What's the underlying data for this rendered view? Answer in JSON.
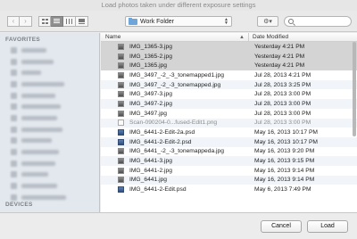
{
  "window": {
    "title": "Load photos taken under different exposure settings"
  },
  "toolbar": {
    "back_glyph": "‹",
    "forward_glyph": "›",
    "view_modes": [
      "icon-view",
      "list-view",
      "column-view",
      "cover-flow-view"
    ],
    "active_view": "list-view",
    "folder": "Work Folder",
    "action_glyph": "⚙▾",
    "search": {
      "value": "",
      "placeholder": ""
    }
  },
  "sidebar": {
    "favorites_heading": "FAVORITES",
    "devices_heading": "DEVICES",
    "items_count_note": ""
  },
  "filelist": {
    "columns": {
      "name": "Name",
      "date": "Date Modified"
    },
    "sort_glyph": "▲",
    "rows": [
      {
        "name": "IMG_1365-3.jpg",
        "date": "Yesterday 4:21 PM",
        "kind": "jpg",
        "state": "selected"
      },
      {
        "name": "IMG_1365-2.jpg",
        "date": "Yesterday 4:21 PM",
        "kind": "jpg",
        "state": "selected"
      },
      {
        "name": "IMG_1365.jpg",
        "date": "Yesterday 4:21 PM",
        "kind": "jpg",
        "state": "selected"
      },
      {
        "name": "IMG_3497_-2_-3_tonemapped1.jpg",
        "date": "Jul 28, 2013 4:21 PM",
        "kind": "jpg",
        "state": "normal"
      },
      {
        "name": "IMG_3497_-2_-3_tonemapped.jpg",
        "date": "Jul 28, 2013 3:25 PM",
        "kind": "jpg",
        "state": "alt"
      },
      {
        "name": "IMG_3497-3.jpg",
        "date": "Jul 28, 2013 3:00 PM",
        "kind": "jpg",
        "state": "normal"
      },
      {
        "name": "IMG_3497-2.jpg",
        "date": "Jul 28, 2013 3:00 PM",
        "kind": "jpg",
        "state": "alt"
      },
      {
        "name": "IMG_3497.jpg",
        "date": "Jul 28, 2013 3:00 PM",
        "kind": "jpg",
        "state": "normal"
      },
      {
        "name": "Scan-090204-0...fused-Edit1.png",
        "date": "Jul 28, 2013 3:00 PM",
        "kind": "png",
        "state": "alt dim"
      },
      {
        "name": "IMG_6441-2-Edit-2a.psd",
        "date": "May 16, 2013 10:17 PM",
        "kind": "psd",
        "state": "normal"
      },
      {
        "name": "IMG_6441-2-Edit-2.psd",
        "date": "May 16, 2013 10:17 PM",
        "kind": "psd",
        "state": "alt"
      },
      {
        "name": "IMG_6441_-2_-3_tonemappeda.jpg",
        "date": "May 16, 2013 9:20 PM",
        "kind": "jpg",
        "state": "normal"
      },
      {
        "name": "IMG_6441-3.jpg",
        "date": "May 16, 2013 9:15 PM",
        "kind": "jpg",
        "state": "alt"
      },
      {
        "name": "IMG_6441-2.jpg",
        "date": "May 16, 2013 9:14 PM",
        "kind": "jpg",
        "state": "normal"
      },
      {
        "name": "IMG_6441.jpg",
        "date": "May 16, 2013 9:14 PM",
        "kind": "jpg",
        "state": "alt"
      },
      {
        "name": "IMG_6441-2-Edit.psd",
        "date": "May 6, 2013 7:49 PM",
        "kind": "psd",
        "state": "normal"
      }
    ]
  },
  "buttons": {
    "cancel": "Cancel",
    "load": "Load"
  },
  "colors": {
    "selection": "#d4d4d4",
    "folder_accent": "#6ea6dc",
    "sidebar_bg": "#e3e8ee"
  }
}
